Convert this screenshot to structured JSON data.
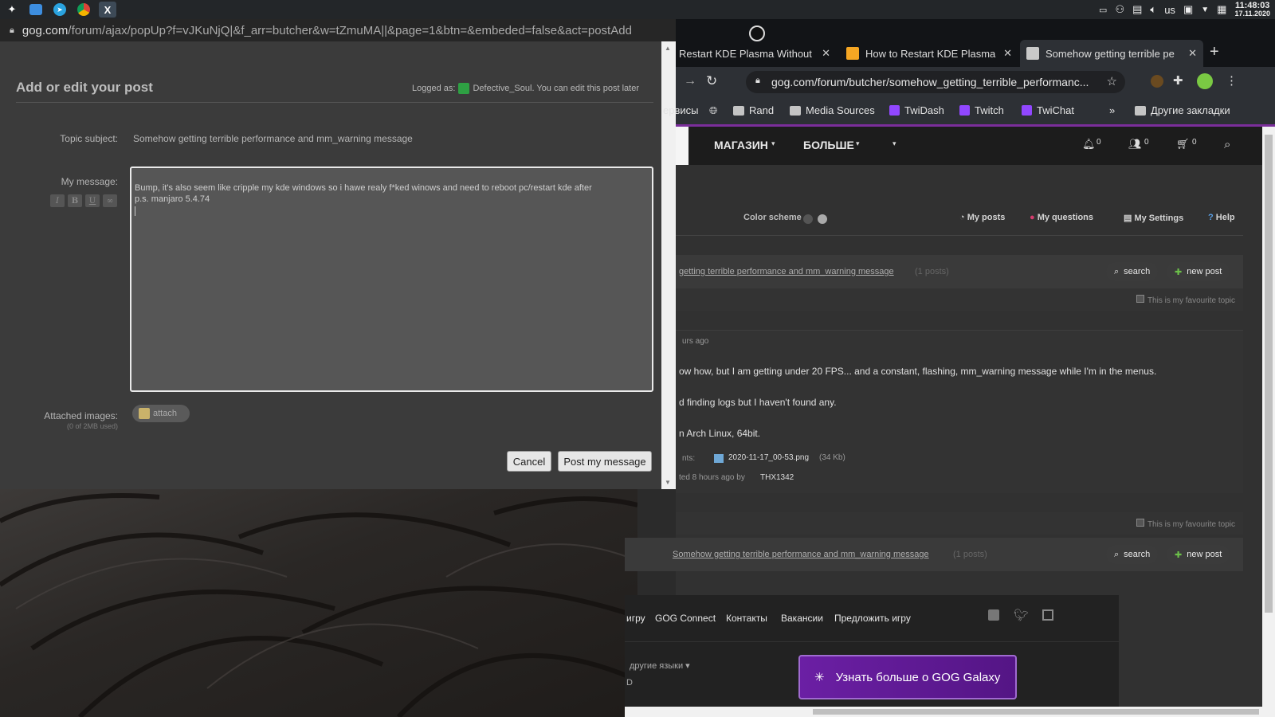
{
  "taskbar": {
    "lang": "us",
    "time": "11:48:03",
    "date": "17.11.2020"
  },
  "popup": {
    "url_main": "gog.com",
    "url_rest": "/forum/ajax/popUp?f=vJKuNjQ|&f_arr=butcher&w=tZmuMA||&page=1&btn=&embeded=false&act=postAdd",
    "title": "Add or edit your post",
    "logged_as_label": "Logged as:",
    "username": "Defective_Soul",
    "edit_note": ". You can edit this post later",
    "topic_label": "Topic subject:",
    "topic_value": "Somehow getting terrible performance and mm_warning message",
    "message_label": "My message:",
    "format_buttons": [
      "I",
      "B",
      "U",
      "∞"
    ],
    "message_line1": "Bump, it's also seem like cripple my kde windows so i hawe realy f*ked winows and need to reboot pc/restart kde after",
    "message_line2": "p.s. manjaro 5.4.74",
    "attached_label": "Attached images:",
    "attach_btn": "attach",
    "used_note": "(0 of 2MB used)",
    "cancel_btn": "Cancel",
    "post_btn": "Post my message"
  },
  "browser": {
    "tabs": [
      {
        "label": "Restart KDE Plasma Without"
      },
      {
        "label": "How to Restart KDE Plasma"
      },
      {
        "label": "Somehow getting terrible pe"
      }
    ],
    "new_tab": "+",
    "url": "gog.com/forum/butcher/somehow_getting_terrible_performanc...",
    "bookmarks": [
      {
        "label": "ервисы"
      },
      {
        "label": "Rand"
      },
      {
        "label": "Media Sources"
      },
      {
        "label": "TwiDash"
      },
      {
        "label": "Twitch"
      },
      {
        "label": "TwiChat"
      },
      {
        "label": "»"
      },
      {
        "label": "Другие закладки"
      }
    ],
    "nav": {
      "store": "МАГАЗИН",
      "more": "БОЛЬШЕ",
      "notif_count": "0",
      "friends_count": "0",
      "cart_count": "0"
    },
    "subnav": {
      "color_scheme": "Color scheme",
      "my_posts": "My posts",
      "my_questions": "My questions",
      "my_settings": "My Settings",
      "help": "Help"
    },
    "thread": {
      "title_fragment": "getting terrible performance and mm_warning message",
      "title_full": "Somehow getting terrible performance and mm_warning message",
      "post_count": "(1 posts)",
      "search": "search",
      "new_post": "new post",
      "favourite": "This is my favourite topic",
      "time_ago": "urs ago",
      "line1": "ow how, but I am getting under 20 FPS... and a constant, flashing, mm_warning message while I'm in the menus.",
      "line2": "d finding logs but I haven't found any.",
      "line3": "n Arch Linux, 64bit.",
      "attachments_label": "nts:",
      "attachment_file": "2020-11-17_00-53.png",
      "attachment_size": "(34 Kb)",
      "posted": "ted 8 hours ago by",
      "author": "THX1342"
    },
    "footer": {
      "links": [
        "игру",
        "GOG Connect",
        "Контакты",
        "Вакансии",
        "Предложить игру"
      ],
      "other_langs": "другие языки",
      "letter": "D",
      "galaxy_btn": "Узнать больше о GOG Galaxy"
    }
  }
}
